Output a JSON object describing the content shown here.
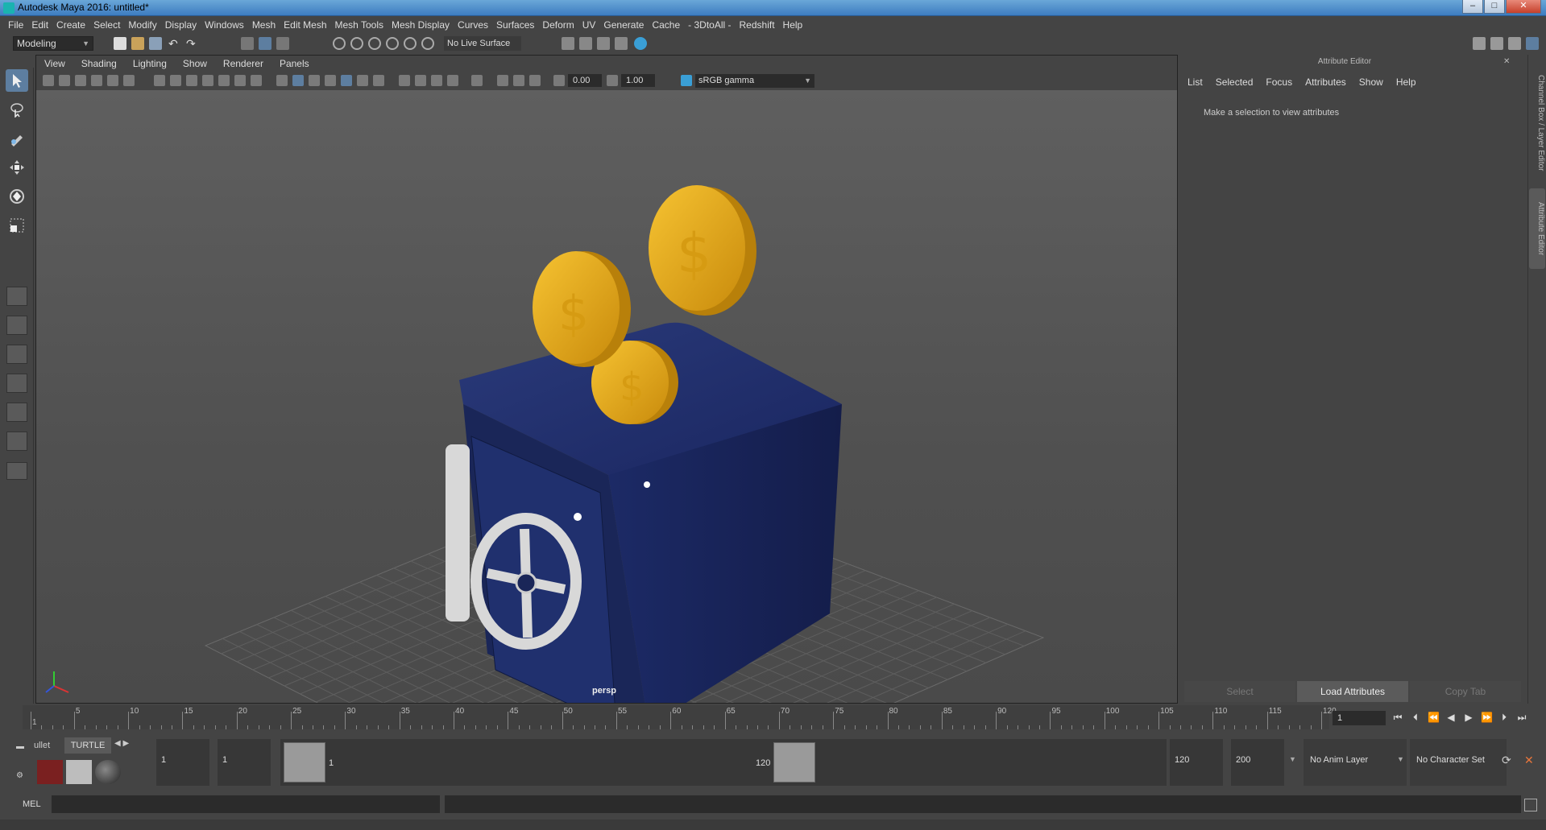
{
  "window": {
    "title": "Autodesk Maya 2016: untitled*",
    "min": "–",
    "max": "□",
    "close": "✕"
  },
  "menu": [
    "File",
    "Edit",
    "Create",
    "Select",
    "Modify",
    "Display",
    "Windows",
    "Mesh",
    "Edit Mesh",
    "Mesh Tools",
    "Mesh Display",
    "Curves",
    "Surfaces",
    "Deform",
    "UV",
    "Generate",
    "Cache",
    "- 3DtoAll -",
    "Redshift",
    "Help"
  ],
  "shelf": {
    "mode": "Modeling",
    "live_surface": "No Live Surface"
  },
  "viewport": {
    "menu": [
      "View",
      "Shading",
      "Lighting",
      "Show",
      "Renderer",
      "Panels"
    ],
    "exposure": "0.00",
    "gamma_value": "1.00",
    "color_space": "sRGB gamma",
    "camera": "persp"
  },
  "attribute_editor": {
    "header": "Attribute Editor",
    "menu": [
      "List",
      "Selected",
      "Focus",
      "Attributes",
      "Show",
      "Help"
    ],
    "message": "Make a selection to view attributes",
    "buttons": [
      "Select",
      "Load Attributes",
      "Copy Tab"
    ]
  },
  "side_tabs": [
    "Channel Box / Layer Editor",
    "Attribute Editor"
  ],
  "timeline": {
    "ticks": [
      1,
      5,
      10,
      15,
      20,
      25,
      30,
      35,
      40,
      45,
      50,
      55,
      60,
      65,
      70,
      75,
      80,
      85,
      90,
      95,
      100,
      105,
      110,
      115,
      120
    ],
    "current_frame": "1"
  },
  "range": {
    "shelf_tabs": [
      "ullet",
      "TURTLE"
    ],
    "start": "1",
    "playback_start": "1",
    "slider_start": "1",
    "slider_end": "120",
    "playback_end": "120",
    "end": "200",
    "anim_layer": "No Anim Layer",
    "character_set": "No Character Set"
  },
  "command": {
    "label": "MEL"
  },
  "colors": {
    "safe": "#1d2a5c",
    "coin": "#e0a317",
    "handle": "#d9d9d9",
    "accent": "#5d7ea0"
  }
}
